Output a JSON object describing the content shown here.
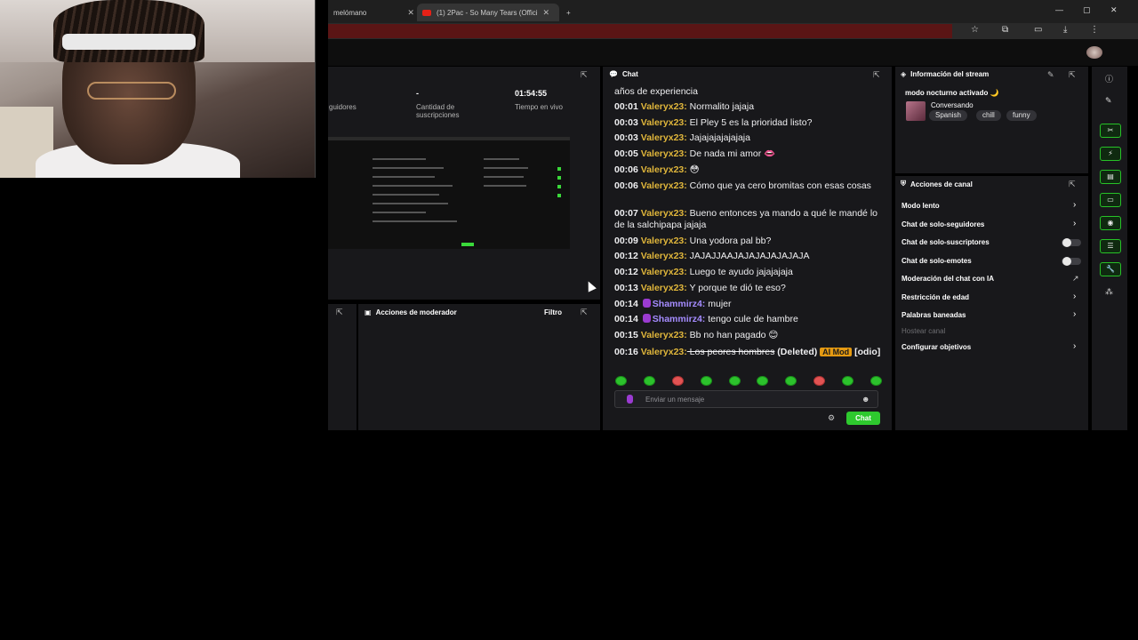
{
  "browser": {
    "tab1": "melómano",
    "tab2": "(1) 2Pac - So Many Tears (Offici",
    "tab_close": "✕",
    "new_tab": "+",
    "min": "—",
    "max": "▢",
    "close": "✕"
  },
  "stats": {
    "followers_label": "guidores",
    "subs_value": "-",
    "subs_label": "Cantidad de suscripciones",
    "live_value": "01:54:55",
    "live_label": "Tiempo en vivo"
  },
  "chat": {
    "title": "Chat",
    "partial_top_1": "",
    "partial_top_2": "años de experiencia",
    "messages": [
      {
        "time": "00:01",
        "user": "Valeryx23:",
        "text": " Normalito jajaja"
      },
      {
        "time": "00:03",
        "user": "Valeryx23:",
        "text": " El Pley 5 es la prioridad listo?"
      },
      {
        "time": "00:03",
        "user": "Valeryx23:",
        "text": " Jajajajajajajaja"
      },
      {
        "time": "00:05",
        "user": "Valeryx23:",
        "text": " De nada mi amor 👄"
      },
      {
        "time": "00:06",
        "user": "Valeryx23:",
        "text": " 😳"
      },
      {
        "time": "00:06",
        "user": "Valeryx23:",
        "text": " Cómo que ya cero bromitas con esas cosas"
      },
      {
        "time": "00:07",
        "user": "Valeryx23:",
        "text": " Bueno entonces ya mando a qué le mandé lo de la salchipapa jajaja"
      },
      {
        "time": "00:09",
        "user": "Valeryx23:",
        "text": " Una yodora pal bb?"
      },
      {
        "time": "00:12",
        "user": "Valeryx23:",
        "text": " JAJAJJAAJAJAJAJAJAJAJA"
      },
      {
        "time": "00:12",
        "user": "Valeryx23:",
        "text": " Luego te ayudo jajajajaja"
      },
      {
        "time": "00:13",
        "user": "Valeryx23:",
        "text": " Y porque te dió te eso?"
      },
      {
        "time": "00:14",
        "user": "Shammirz4:",
        "text": " mujer"
      },
      {
        "time": "00:14",
        "user": "Shammirz4:",
        "text": " tengo cule de hambre"
      },
      {
        "time": "00:15",
        "user": "Valeryx23:",
        "text": " Bb no han pagado 😊"
      }
    ],
    "deleted": {
      "time": "00:16",
      "user": "Valeryx23:",
      "struck": " Los peores hombres",
      "tag": " (Deleted) ",
      "aimod": "AI Mod",
      "reason": " [odio]"
    },
    "input_placeholder": "Enviar un mensaje",
    "send_label": "Chat"
  },
  "moderator": {
    "title": "Acciones de moderador",
    "filter": "Filtro"
  },
  "stream_info": {
    "title": "Información del stream",
    "stream_title": "modo nocturno activado 🌙",
    "category": "Conversando",
    "tags": [
      "Spanish",
      "chill",
      "funny"
    ]
  },
  "channel_actions": {
    "title": "Acciones de canal",
    "items": [
      "Modo lento",
      "Chat de solo-seguidores",
      "Chat de solo-suscriptores",
      "Chat de solo-emotes",
      "Moderación del chat con IA",
      "Restricción de edad",
      "Palabras baneadas",
      "Hostear canal",
      "Configurar objetivos"
    ]
  },
  "colors": {
    "accent": "#2ec92e",
    "username": "#e0b63b",
    "username_alt": "#a58cff",
    "ai_mod": "#e59a12"
  }
}
